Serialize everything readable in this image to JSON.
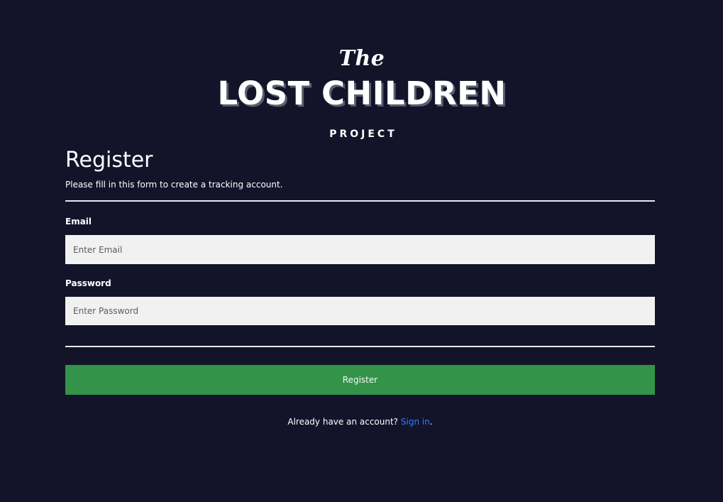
{
  "logo": {
    "line1": "The",
    "line2": "LOST CHILDREN",
    "line3": "PROJECT"
  },
  "form": {
    "title": "Register",
    "subtitle": "Please fill in this form to create a tracking account.",
    "email_label": "Email",
    "email_placeholder": "Enter Email",
    "email_value": "",
    "password_label": "Password",
    "password_placeholder": "Enter Password",
    "password_value": "",
    "submit_label": "Register"
  },
  "signin": {
    "prompt": "Already have an account? ",
    "link_text": "Sign in",
    "suffix": "."
  },
  "colors": {
    "background": "#13142a",
    "button": "#34984a",
    "link": "#2f7cf6",
    "input_background": "#f1f1f1"
  }
}
